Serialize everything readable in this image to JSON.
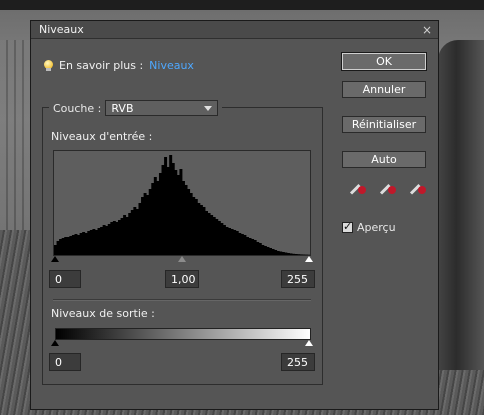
{
  "dialog": {
    "title": "Niveaux",
    "close_glyph": "×"
  },
  "help": {
    "prefix": "En savoir plus :",
    "link": "Niveaux",
    "icon": "lightbulb-icon"
  },
  "channel": {
    "label": "Couche :",
    "value": "RVB"
  },
  "input_levels": {
    "label": "Niveaux d'entrée :",
    "black": "0",
    "gamma": "1,00",
    "white": "255"
  },
  "output_levels": {
    "label": "Niveaux de sortie :",
    "black": "0",
    "white": "255"
  },
  "buttons": {
    "ok": "OK",
    "cancel": "Annuler",
    "reset": "Réinitialiser",
    "auto": "Auto"
  },
  "droppers": [
    "black-point-eyedropper-icon",
    "gray-point-eyedropper-icon",
    "white-point-eyedropper-icon"
  ],
  "preview": {
    "label": "Aperçu",
    "checked": true
  },
  "colors": {
    "dialog_bg": "#555555",
    "link": "#4ea8ff"
  },
  "chart_data": {
    "type": "bar",
    "title": "",
    "xlabel": "",
    "ylabel": "",
    "xlim": [
      0,
      255
    ],
    "ylim": [
      0,
      1
    ],
    "values": [
      0.1,
      0.14,
      0.16,
      0.17,
      0.18,
      0.18,
      0.19,
      0.2,
      0.21,
      0.2,
      0.22,
      0.23,
      0.22,
      0.24,
      0.25,
      0.26,
      0.25,
      0.27,
      0.28,
      0.3,
      0.29,
      0.31,
      0.33,
      0.34,
      0.33,
      0.35,
      0.37,
      0.4,
      0.38,
      0.42,
      0.45,
      0.48,
      0.46,
      0.52,
      0.58,
      0.62,
      0.6,
      0.66,
      0.72,
      0.78,
      0.74,
      0.82,
      0.9,
      0.98,
      0.88,
      1.0,
      0.92,
      0.85,
      0.8,
      0.86,
      0.74,
      0.7,
      0.66,
      0.62,
      0.58,
      0.56,
      0.52,
      0.5,
      0.48,
      0.44,
      0.42,
      0.4,
      0.38,
      0.36,
      0.34,
      0.32,
      0.3,
      0.28,
      0.27,
      0.26,
      0.25,
      0.24,
      0.22,
      0.21,
      0.2,
      0.18,
      0.17,
      0.16,
      0.15,
      0.13,
      0.12,
      0.1,
      0.09,
      0.08,
      0.07,
      0.06,
      0.05,
      0.04,
      0.035,
      0.03,
      0.025,
      0.02,
      0.016,
      0.012,
      0.01,
      0.008,
      0.006,
      0.005,
      0.004,
      0.003
    ]
  }
}
